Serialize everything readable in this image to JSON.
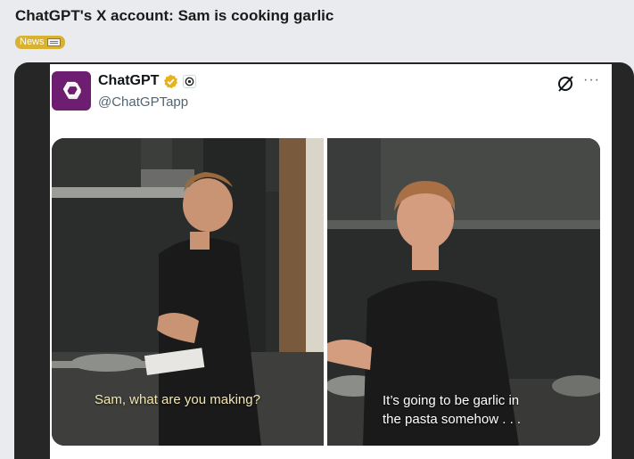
{
  "post": {
    "title": "ChatGPT's X account: Sam is cooking garlic",
    "tag_label": "News"
  },
  "tweet": {
    "display_name": "ChatGPT",
    "handle": "@ChatGPTapp",
    "more_label": "···",
    "captions": {
      "left": "Sam, what are you making?",
      "right_line1": "It’s going to be garlic in",
      "right_line2": "the pasta somehow . . ."
    }
  },
  "colors": {
    "avatar_bg": "#6e1e71",
    "tag_bg": "#d9b233",
    "verified_badge": "#e8b21a"
  },
  "icons": {
    "tag": "newspaper-icon",
    "avatar": "openai-logo-icon",
    "verified": "verified-badge-icon",
    "affiliation": "affiliate-logo-icon",
    "grok": "grok-icon",
    "more": "more-options-icon"
  }
}
